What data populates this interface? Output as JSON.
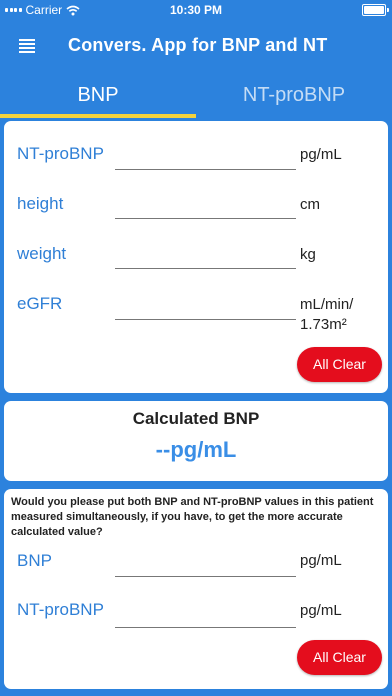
{
  "status_bar": {
    "carrier": "Carrier",
    "time": "10:30 PM"
  },
  "app_bar": {
    "title": "Convers. App for BNP and NT",
    "menu_icon": "hamburger-menu-icon"
  },
  "tabs": [
    {
      "label": "BNP",
      "active": true
    },
    {
      "label": "NT-proBNP",
      "active": false
    }
  ],
  "input_card": {
    "fields": [
      {
        "label": "NT-proBNP",
        "value": "",
        "unit": "pg/mL"
      },
      {
        "label": "height",
        "value": "",
        "unit": "cm"
      },
      {
        "label": "weight",
        "value": "",
        "unit": "kg"
      },
      {
        "label": "eGFR",
        "value": "",
        "unit_line1": "mL/min/",
        "unit_line2": "1.73m²"
      }
    ],
    "clear_label": "All Clear"
  },
  "result_card": {
    "title": "Calculated BNP",
    "value": "--pg/mL"
  },
  "measured_card": {
    "instruction": "Would you please put both BNP and NT-proBNP values in this patient measured simultaneously, if you have, to get the more accurate calculated value?",
    "fields": [
      {
        "label": "BNP",
        "value": "",
        "unit": "pg/mL"
      },
      {
        "label": "NT-proBNP",
        "value": "",
        "unit": "pg/mL"
      }
    ],
    "clear_label": "All Clear"
  },
  "colors": {
    "background": "#2c82dd",
    "accent": "#2f7fd6",
    "tab_indicator": "#f4d23d",
    "clear_button": "#e40d1d"
  }
}
